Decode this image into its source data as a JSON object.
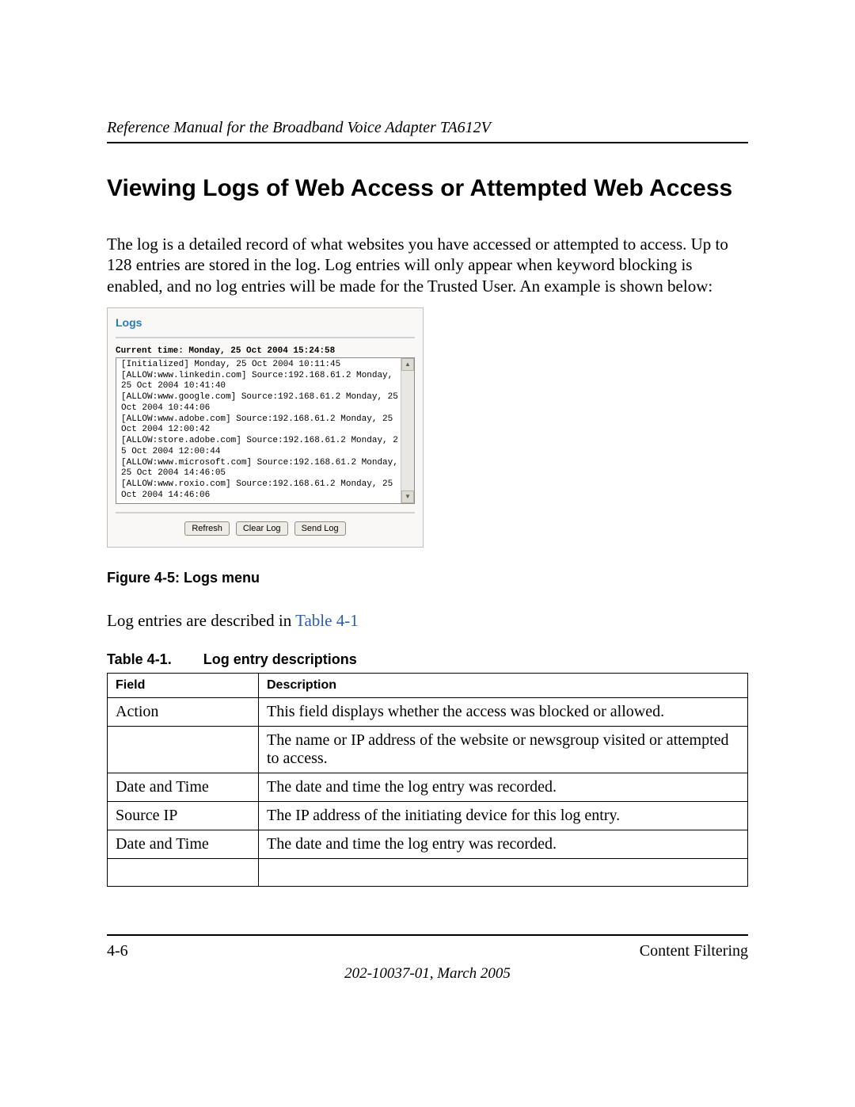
{
  "header": {
    "running": "Reference Manual for the Broadband Voice Adapter TA612V"
  },
  "title": "Viewing Logs of Web Access or Attempted Web Access",
  "intro": "The log is a detailed record of what websites you have accessed or attempted to access. Up to 128 entries are stored in the log. Log entries will only appear when keyword blocking is enabled, and no log entries will be made for the Trusted User. An example is shown below:",
  "screenshot": {
    "title": "Logs",
    "current_time": "Current time: Monday, 25 Oct 2004 15:24:58",
    "log": "[Initialized] Monday, 25 Oct 2004 10:11:45\n[ALLOW:www.linkedin.com] Source:192.168.61.2 Monday, 25 Oct 2004 10:41:40\n[ALLOW:www.google.com] Source:192.168.61.2 Monday, 25 Oct 2004 10:44:06\n[ALLOW:www.adobe.com] Source:192.168.61.2 Monday, 25 Oct 2004 12:00:42\n[ALLOW:store.adobe.com] Source:192.168.61.2 Monday, 25 Oct 2004 12:00:44\n[ALLOW:www.microsoft.com] Source:192.168.61.2 Monday, 25 Oct 2004 14:46:05\n[ALLOW:www.roxio.com] Source:192.168.61.2 Monday, 25 Oct 2004 14:46:06",
    "buttons": {
      "refresh": "Refresh",
      "clear": "Clear Log",
      "send": "Send Log"
    }
  },
  "figure_caption": "Figure 4-5:  Logs menu",
  "described_prefix": "Log entries are described in ",
  "described_link": "Table 4-1",
  "table": {
    "caption_num": "Table 4-1.",
    "caption_title": "Log entry descriptions",
    "head_field": "Field",
    "head_desc": "Description",
    "rows": [
      {
        "field": "Action",
        "desc": "This field displays whether the access was blocked or allowed."
      },
      {
        "field": "",
        "desc": "The name or IP address of the website or newsgroup visited or attempted to access."
      },
      {
        "field": "Date and Time",
        "desc": "The date and time the log entry was recorded."
      },
      {
        "field": "Source IP",
        "desc": "The IP address of the initiating device for this log entry."
      },
      {
        "field": "Date and Time",
        "desc": "The date and time the log entry was recorded."
      },
      {
        "field": "",
        "desc": ""
      }
    ]
  },
  "footer": {
    "page": "4-6",
    "section": "Content Filtering",
    "date": "202-10037-01, March 2005"
  }
}
